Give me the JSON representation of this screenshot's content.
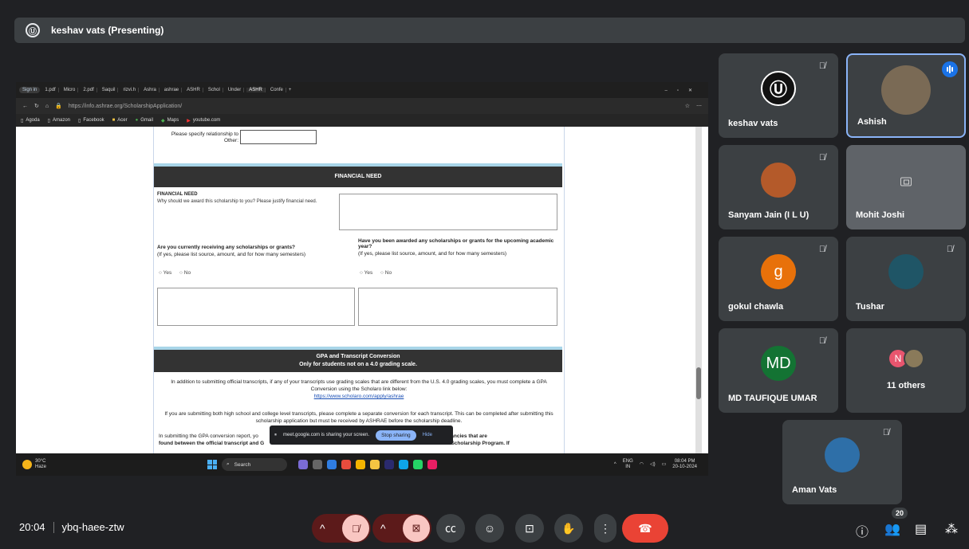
{
  "presenter": {
    "label": "keshav vats (Presenting)"
  },
  "browser": {
    "signin": "Sign in",
    "tabs": [
      "1.pdf",
      "Micro",
      "2.pdf",
      "Saquil",
      "rizvi.h",
      "Ashra",
      "ashrae",
      "ASHR",
      "Schol",
      "Under",
      "ASHR",
      "Confe"
    ],
    "url": "https://info.ashrae.org/ScholarshipApplication/",
    "bookmarks": [
      "Agoda",
      "Amazon",
      "Facebook",
      "Acer",
      "Gmail",
      "Maps",
      "youtube.com"
    ]
  },
  "form": {
    "relationship_label": "Please specify relationship to Other:",
    "financial_section": "FINANCIAL NEED",
    "financial_title": "FINANCIAL NEED",
    "financial_question": "Why should we award this scholarship to you? Please justify financial need.",
    "q1_title": "Are you currently receiving any scholarships or grants?",
    "q1_sub": "(If yes, please list source, amount, and for how many semesters)",
    "q2_title": "Have you been awarded any scholarships or grants for the upcoming academic year?",
    "q2_sub": "(If yes, please list source, amount, and for how many semesters)",
    "yes": "Yes",
    "no": "No",
    "gpa_title": "GPA and Transcript Conversion",
    "gpa_subtitle": "Only for students not on a 4.0 grading scale.",
    "gpa_p1": "In addition to submitting official transcripts, if any of your transcripts use grading scales that are different from the U.S. 4.0 grading scales, you must complete a GPA Conversion using the Scholaro link below:",
    "gpa_link": "https://www.scholaro.com/apply/ashrae",
    "gpa_p2": "If you are submitting both high school and college level transcripts, please complete a separate conversion for each transcript. This can be completed after submitting this scholarship application but must be received by ASHRAE before the scholarship deadline.",
    "gpa_p3a": "In submitting the GPA conversion report, yo",
    "gpa_p3b": "tion entered. Any discrepancies that are",
    "gpa_p4a": "found between the official transcript and G",
    "gpa_p4b": "rom the ASHRAE Scholarship Program. If"
  },
  "share_notice": {
    "text": "meet.google.com is sharing your screen.",
    "stop": "Stop sharing",
    "hide": "Hide"
  },
  "taskbar": {
    "temp": "30°C",
    "weather": "Haze",
    "search": "Search",
    "lang1": "ENG",
    "lang2": "IN",
    "time": "08:04 PM",
    "date": "20-10-2024"
  },
  "participants": [
    {
      "name": "keshav vats"
    },
    {
      "name": "Ashish"
    },
    {
      "name": "Sanyam Jain (I L U)"
    },
    {
      "name": "Mohit Joshi"
    },
    {
      "name": "gokul chawla",
      "initial": "g"
    },
    {
      "name": "Tushar"
    },
    {
      "name": "MD TAUFIQUE UMAR",
      "initial": "MD"
    },
    {
      "name": "11 others",
      "initial": "N"
    },
    {
      "name": "Aman Vats"
    }
  ],
  "meeting": {
    "time": "20:04",
    "code": "ybq-haee-ztw",
    "participant_count": "20"
  },
  "colors": {
    "accent": "#8ab4f8",
    "end_call": "#ea4335",
    "gokul": "#e8710a",
    "md": "#137333"
  }
}
